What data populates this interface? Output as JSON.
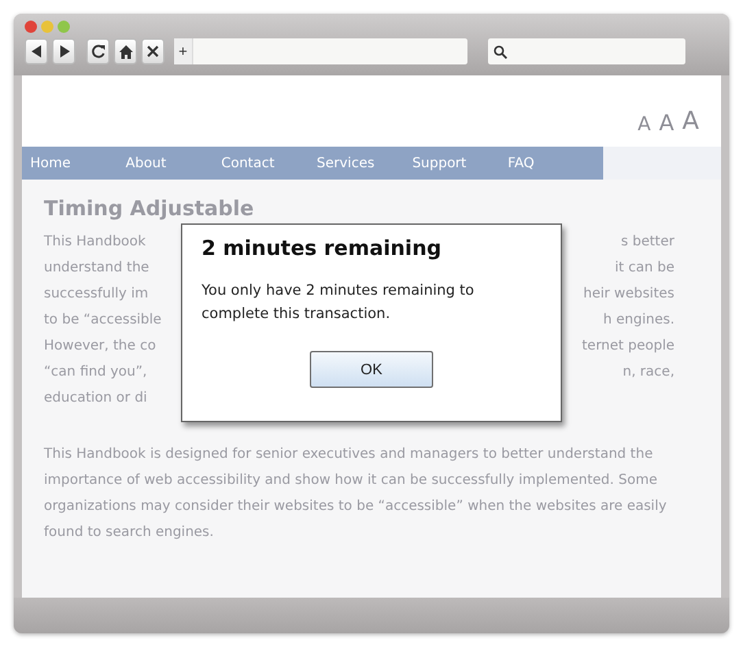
{
  "browser": {
    "toolbar_buttons": [
      {
        "kind": "back"
      },
      {
        "kind": "forward"
      },
      {
        "kind": "reload"
      },
      {
        "kind": "home"
      },
      {
        "kind": "stop"
      }
    ],
    "address_button": "+"
  },
  "page": {
    "text_size_buttons": [
      "A",
      "A",
      "A"
    ],
    "nav": [
      "Home",
      "About",
      "Contact",
      "Services",
      "Support",
      "FAQ"
    ],
    "heading": "Timing Adjustable",
    "covered_lines": [
      {
        "left": "This Handbook",
        "right": "s better"
      },
      {
        "left": "understand the",
        "right": "it can be"
      },
      {
        "left": "successfully im",
        "right": "heir websites"
      },
      {
        "left": "to be “accessible",
        "right": "h engines."
      },
      {
        "left": "However, the co",
        "right": "ternet people"
      },
      {
        "left": "“can find you”,",
        "right": "n, race,"
      },
      {
        "left": "education or di"
      }
    ],
    "paragraph": "This Handbook is designed for senior executives and managers to better understand the importance of web accessibility and show how it can be successfully implemented. Some organizations may consider their websites to be “accessible” when the websites are easily found to search engines."
  },
  "dialog": {
    "title": "2 minutes remaining",
    "message": "You only have 2 minutes remaining to complete this transaction.",
    "button": "OK"
  }
}
